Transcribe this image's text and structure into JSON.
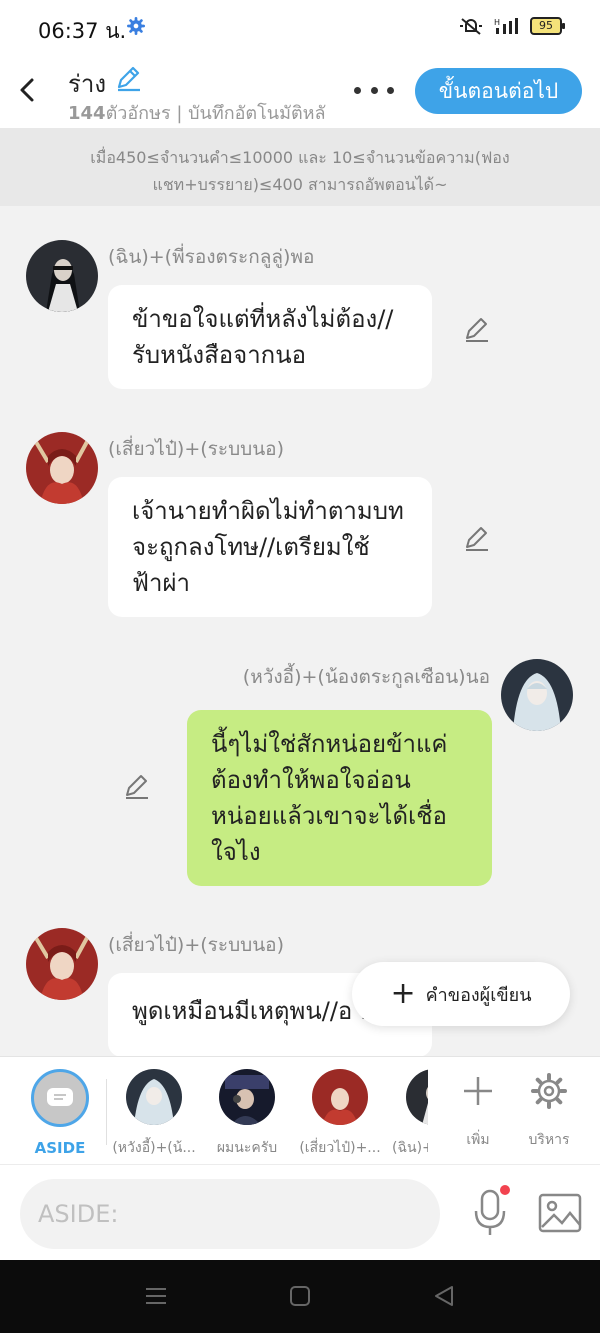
{
  "status": {
    "time": "06:37 น.",
    "battery": "95"
  },
  "header": {
    "title": "ร่าง",
    "char_count": "144",
    "subtitle_rest": "ตัวอักษร | บันทึกอัตโนมัติหลั",
    "next_label": "ขั้นตอนต่อไป"
  },
  "notice": "เมื่อ450≤จำนวนคำ≤10000 และ 10≤จำนวนข้อความ(ฟองแชท+บรรยาย)≤400 สามารถอัพตอนได้~",
  "messages": [
    {
      "name": "(ฉิน)+(พี่รองตระกลูลู่)พอ",
      "text": "ข้าขอใจแต่ที่หลังไม่ต้อง//รับหนังสือจากนอ",
      "side": "left",
      "avatar_color": "#2a2d33"
    },
    {
      "name": "(เสี่ยวไป๋)+(ระบบนอ)",
      "text": "เจ้านายทำผิดไม่ทำตามบทจะถูกลงโทษ//เตรียมใช้ฟ้าผ่า",
      "side": "left",
      "avatar_color": "#9b2a25"
    },
    {
      "name": "(หวังอี้)+(น้องตระกูลเซือน)นอ",
      "text": "นี้ๆไม่ใช่สักหน่อยข้าแค่ต้องทำให้พอใจอ่อนหน่อยแล้วเขาจะได้เชื่อใจไง",
      "side": "right",
      "avatar_color": "#b7c7cf"
    },
    {
      "name": "(เสี่ยวไป๋)+(ระบบนอ)",
      "text": "พูดเหมือนมีเหตุพน//อ อยู่",
      "side": "left",
      "avatar_color": "#9b2a25"
    }
  ],
  "author_button": {
    "label": "คำของผู้เขียน"
  },
  "characters": [
    {
      "label": "ASIDE"
    },
    {
      "label": "(หวังอี้)+(น้..."
    },
    {
      "label": "ผมนะครับ"
    },
    {
      "label": "(เสี่ยวไป๋)+..."
    },
    {
      "label": "(ฉิน)+"
    }
  ],
  "tools": {
    "add": "เพิ่ม",
    "manage": "บริหาร"
  },
  "input": {
    "placeholder": "ASIDE:"
  }
}
